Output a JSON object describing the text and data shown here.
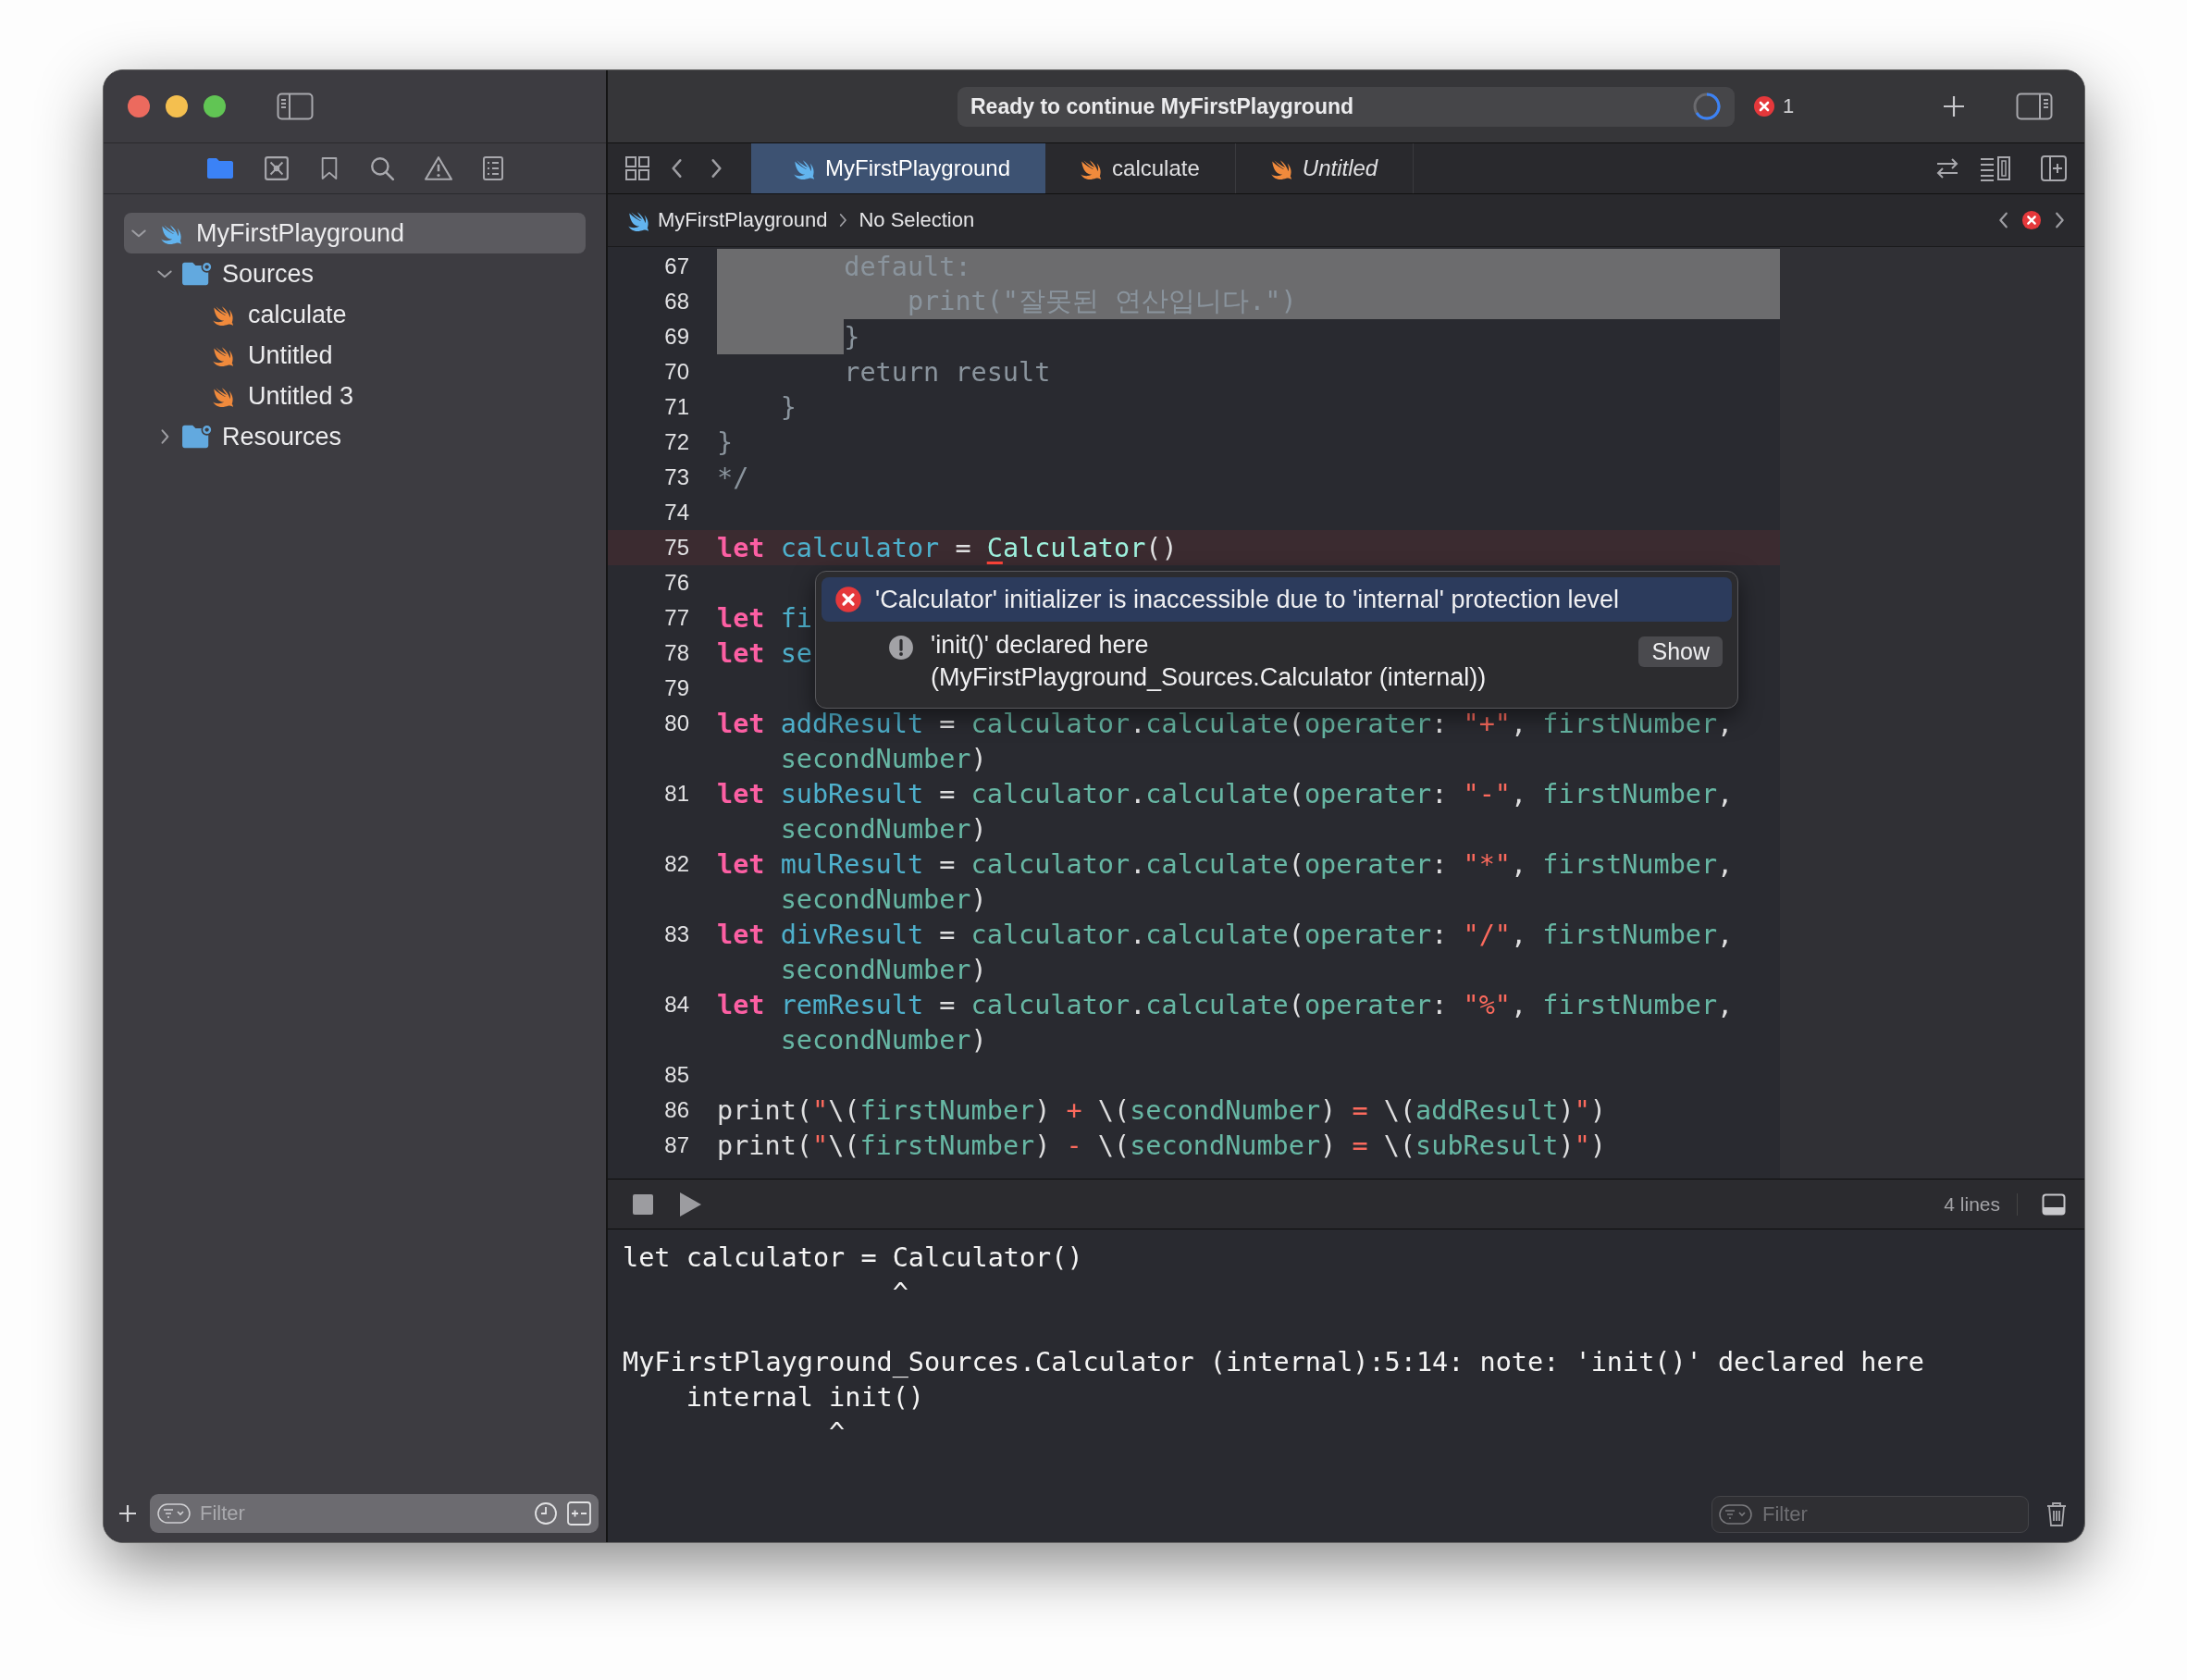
{
  "window": {
    "status": "Ready to continue MyFirstPlayground",
    "error_count": "1"
  },
  "navigator": {
    "tabs": [
      {
        "kind": "folder",
        "selected": true
      },
      {
        "kind": "source-control",
        "selected": false
      },
      {
        "kind": "bookmark",
        "selected": false
      },
      {
        "kind": "search",
        "selected": false
      },
      {
        "kind": "issues",
        "selected": false
      },
      {
        "kind": "reports",
        "selected": false
      }
    ]
  },
  "tree": [
    {
      "label": "MyFirstPlayground",
      "kind": "project",
      "expanded": true,
      "selected": true,
      "children": [
        {
          "label": "Sources",
          "kind": "folder",
          "expanded": true,
          "selected": false,
          "children": [
            {
              "label": "calculate",
              "kind": "file",
              "selected": false
            },
            {
              "label": "Untitled",
              "kind": "file",
              "selected": false
            },
            {
              "label": "Untitled 3",
              "kind": "file",
              "selected": false
            }
          ]
        },
        {
          "label": "Resources",
          "kind": "folder",
          "expanded": false,
          "selected": false
        }
      ]
    }
  ],
  "sidebar_filter": {
    "placeholder": "Filter"
  },
  "tabs": [
    {
      "label": "MyFirstPlayground",
      "selected": true,
      "italic": false
    },
    {
      "label": "calculate",
      "selected": false,
      "italic": false
    },
    {
      "label": "Untitled",
      "selected": false,
      "italic": true
    }
  ],
  "breadcrumb": {
    "items": [
      "MyFirstPlayground",
      "No Selection"
    ]
  },
  "editor": {
    "lines": [
      {
        "number": "67",
        "selected": true,
        "error": false,
        "segments": [
          {
            "text": "        default:",
            "kind": "comment"
          }
        ]
      },
      {
        "number": "68",
        "selected": true,
        "error": false,
        "segments": [
          {
            "text": "            print(\"잘못된 연산입니다.\")",
            "kind": "comment"
          }
        ]
      },
      {
        "number": "69",
        "selected": true,
        "error": false,
        "segments": [
          {
            "text": "        }",
            "kind": "comment"
          }
        ]
      },
      {
        "number": "70",
        "selected": false,
        "error": false,
        "segments": [
          {
            "text": "        return result",
            "kind": "comment"
          }
        ]
      },
      {
        "number": "71",
        "selected": false,
        "error": false,
        "segments": [
          {
            "text": "    }",
            "kind": "comment"
          }
        ]
      },
      {
        "number": "72",
        "selected": false,
        "error": false,
        "segments": [
          {
            "text": "}",
            "kind": "comment"
          }
        ]
      },
      {
        "number": "73",
        "selected": false,
        "error": false,
        "segments": [
          {
            "text": "*/",
            "kind": "comment"
          }
        ]
      },
      {
        "number": "74",
        "selected": false,
        "error": false
      },
      {
        "number": "75",
        "selected": false,
        "error": true,
        "segments": [
          {
            "text": "let ",
            "kind": "kw"
          },
          {
            "text": "calculator",
            "kind": "decl"
          },
          {
            "text": " = ",
            "kind": "plain"
          },
          {
            "text": "C",
            "kind": "type",
            "flagged": true
          },
          {
            "text": "alculator",
            "kind": "type"
          },
          {
            "text": "()",
            "kind": "plain"
          }
        ]
      },
      {
        "number": "76",
        "selected": false,
        "error": false
      },
      {
        "number": "77",
        "selected": false,
        "error": false,
        "segments": [
          {
            "text": "let ",
            "kind": "kw"
          },
          {
            "text": "fi",
            "kind": "decl"
          }
        ]
      },
      {
        "number": "78",
        "selected": false,
        "error": false,
        "segments": [
          {
            "text": "let ",
            "kind": "kw"
          },
          {
            "text": "se",
            "kind": "decl"
          }
        ]
      },
      {
        "number": "79",
        "selected": false,
        "error": false
      },
      {
        "number": "80",
        "selected": false,
        "error": false,
        "segments": [
          {
            "text": "let ",
            "kind": "kw"
          },
          {
            "text": "addResult",
            "kind": "decl"
          },
          {
            "text": " = ",
            "kind": "plain"
          },
          {
            "text": "calculator",
            "kind": "ident"
          },
          {
            "text": ".",
            "kind": "plain"
          },
          {
            "text": "calculate",
            "kind": "ident"
          },
          {
            "text": "(",
            "kind": "plain"
          },
          {
            "text": "operater",
            "kind": "ident"
          },
          {
            "text": ": ",
            "kind": "plain"
          },
          {
            "text": "\"+\"",
            "kind": "str"
          },
          {
            "text": ", ",
            "kind": "plain"
          },
          {
            "text": "firstNumber",
            "kind": "ident"
          },
          {
            "text": ",",
            "kind": "plain"
          }
        ],
        "continuation": [
          {
            "text": "secondNumber",
            "kind": "ident"
          },
          {
            "text": ")",
            "kind": "plain"
          }
        ]
      },
      {
        "number": "81",
        "selected": false,
        "error": false,
        "segments": [
          {
            "text": "let ",
            "kind": "kw"
          },
          {
            "text": "subResult",
            "kind": "decl"
          },
          {
            "text": " = ",
            "kind": "plain"
          },
          {
            "text": "calculator",
            "kind": "ident"
          },
          {
            "text": ".",
            "kind": "plain"
          },
          {
            "text": "calculate",
            "kind": "ident"
          },
          {
            "text": "(",
            "kind": "plain"
          },
          {
            "text": "operater",
            "kind": "ident"
          },
          {
            "text": ": ",
            "kind": "plain"
          },
          {
            "text": "\"-\"",
            "kind": "str"
          },
          {
            "text": ", ",
            "kind": "plain"
          },
          {
            "text": "firstNumber",
            "kind": "ident"
          },
          {
            "text": ",",
            "kind": "plain"
          }
        ],
        "continuation": [
          {
            "text": "secondNumber",
            "kind": "ident"
          },
          {
            "text": ")",
            "kind": "plain"
          }
        ]
      },
      {
        "number": "82",
        "selected": false,
        "error": false,
        "segments": [
          {
            "text": "let ",
            "kind": "kw"
          },
          {
            "text": "mulResult",
            "kind": "decl"
          },
          {
            "text": " = ",
            "kind": "plain"
          },
          {
            "text": "calculator",
            "kind": "ident"
          },
          {
            "text": ".",
            "kind": "plain"
          },
          {
            "text": "calculate",
            "kind": "ident"
          },
          {
            "text": "(",
            "kind": "plain"
          },
          {
            "text": "operater",
            "kind": "ident"
          },
          {
            "text": ": ",
            "kind": "plain"
          },
          {
            "text": "\"*\"",
            "kind": "str"
          },
          {
            "text": ", ",
            "kind": "plain"
          },
          {
            "text": "firstNumber",
            "kind": "ident"
          },
          {
            "text": ",",
            "kind": "plain"
          }
        ],
        "continuation": [
          {
            "text": "secondNumber",
            "kind": "ident"
          },
          {
            "text": ")",
            "kind": "plain"
          }
        ]
      },
      {
        "number": "83",
        "selected": false,
        "error": false,
        "segments": [
          {
            "text": "let ",
            "kind": "kw"
          },
          {
            "text": "divResult",
            "kind": "decl"
          },
          {
            "text": " = ",
            "kind": "plain"
          },
          {
            "text": "calculator",
            "kind": "ident"
          },
          {
            "text": ".",
            "kind": "plain"
          },
          {
            "text": "calculate",
            "kind": "ident"
          },
          {
            "text": "(",
            "kind": "plain"
          },
          {
            "text": "operater",
            "kind": "ident"
          },
          {
            "text": ": ",
            "kind": "plain"
          },
          {
            "text": "\"/\"",
            "kind": "str"
          },
          {
            "text": ", ",
            "kind": "plain"
          },
          {
            "text": "firstNumber",
            "kind": "ident"
          },
          {
            "text": ",",
            "kind": "plain"
          }
        ],
        "continuation": [
          {
            "text": "secondNumber",
            "kind": "ident"
          },
          {
            "text": ")",
            "kind": "plain"
          }
        ]
      },
      {
        "number": "84",
        "selected": false,
        "error": false,
        "segments": [
          {
            "text": "let ",
            "kind": "kw"
          },
          {
            "text": "remResult",
            "kind": "decl"
          },
          {
            "text": " = ",
            "kind": "plain"
          },
          {
            "text": "calculator",
            "kind": "ident"
          },
          {
            "text": ".",
            "kind": "plain"
          },
          {
            "text": "calculate",
            "kind": "ident"
          },
          {
            "text": "(",
            "kind": "plain"
          },
          {
            "text": "operater",
            "kind": "ident"
          },
          {
            "text": ": ",
            "kind": "plain"
          },
          {
            "text": "\"%\"",
            "kind": "str"
          },
          {
            "text": ", ",
            "kind": "plain"
          },
          {
            "text": "firstNumber",
            "kind": "ident"
          },
          {
            "text": ",",
            "kind": "plain"
          }
        ],
        "continuation": [
          {
            "text": "secondNumber",
            "kind": "ident"
          },
          {
            "text": ")",
            "kind": "plain"
          }
        ]
      },
      {
        "number": "85",
        "selected": false,
        "error": false
      },
      {
        "number": "86",
        "selected": false,
        "error": false,
        "segments": [
          {
            "text": "print(",
            "kind": "plain"
          },
          {
            "text": "\"",
            "kind": "str"
          },
          {
            "text": "\\(",
            "kind": "plain"
          },
          {
            "text": "firstNumber",
            "kind": "ident"
          },
          {
            "text": ")",
            "kind": "plain"
          },
          {
            "text": " + ",
            "kind": "str"
          },
          {
            "text": "\\(",
            "kind": "plain"
          },
          {
            "text": "secondNumber",
            "kind": "ident"
          },
          {
            "text": ")",
            "kind": "plain"
          },
          {
            "text": " = ",
            "kind": "str"
          },
          {
            "text": "\\(",
            "kind": "plain"
          },
          {
            "text": "addResult",
            "kind": "ident"
          },
          {
            "text": ")",
            "kind": "plain"
          },
          {
            "text": "\"",
            "kind": "str"
          },
          {
            "text": ")",
            "kind": "plain"
          }
        ]
      },
      {
        "number": "87",
        "selected": false,
        "error": false,
        "segments": [
          {
            "text": "print(",
            "kind": "plain"
          },
          {
            "text": "\"",
            "kind": "str"
          },
          {
            "text": "\\(",
            "kind": "plain"
          },
          {
            "text": "firstNumber",
            "kind": "ident"
          },
          {
            "text": ")",
            "kind": "plain"
          },
          {
            "text": " - ",
            "kind": "str"
          },
          {
            "text": "\\(",
            "kind": "plain"
          },
          {
            "text": "secondNumber",
            "kind": "ident"
          },
          {
            "text": ")",
            "kind": "plain"
          },
          {
            "text": " = ",
            "kind": "str"
          },
          {
            "text": "\\(",
            "kind": "plain"
          },
          {
            "text": "subResult",
            "kind": "ident"
          },
          {
            "text": ")",
            "kind": "plain"
          },
          {
            "text": "\"",
            "kind": "str"
          },
          {
            "text": ")",
            "kind": "plain"
          }
        ]
      }
    ]
  },
  "issue_popup": {
    "message": "'Calculator' initializer is inaccessible due to 'internal' protection level",
    "note": "'init()' declared here",
    "note_detail": "(MyFirstPlayground_Sources.Calculator (internal))",
    "button": "Show"
  },
  "console": {
    "line_count": "4 lines",
    "blocks": [
      [
        "let calculator = Calculator()",
        "                 ^"
      ],
      [
        "MyFirstPlayground_Sources.Calculator (internal):5:14: note: 'init()' declared here",
        "    internal init()",
        "             ^"
      ]
    ],
    "filter_placeholder": "Filter"
  }
}
